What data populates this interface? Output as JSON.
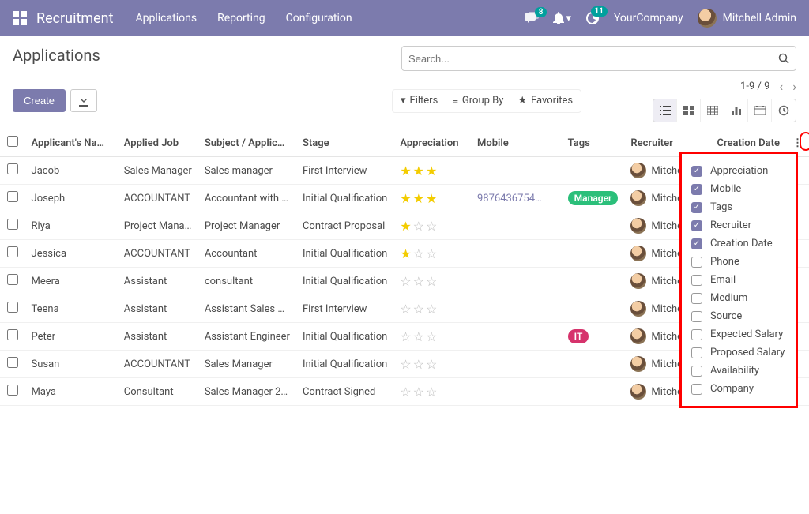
{
  "nav": {
    "brand": "Recruitment",
    "menu": [
      "Applications",
      "Reporting",
      "Configuration"
    ],
    "messages_badge": "8",
    "activities_badge": "11",
    "company": "YourCompany",
    "user": "Mitchell Admin"
  },
  "cp": {
    "title": "Applications",
    "create_label": "Create",
    "search_placeholder": "Search...",
    "filters_label": "Filters",
    "groupby_label": "Group By",
    "favorites_label": "Favorites",
    "pager": "1-9 / 9"
  },
  "columns": {
    "name": "Applicant's Na…",
    "job": "Applied Job",
    "subject": "Subject / Applic…",
    "stage": "Stage",
    "appreciation": "Appreciation",
    "mobile": "Mobile",
    "tags": "Tags",
    "recruiter": "Recruiter",
    "creation_date": "Creation Date"
  },
  "rows": [
    {
      "name": "Jacob",
      "job": "Sales Manager",
      "subject": "Sales manager",
      "stage": "First Interview",
      "appreciation": 3,
      "mobile": "",
      "tags": [],
      "recruiter": "Mitche…"
    },
    {
      "name": "Joseph",
      "job": "ACCOUNTANT",
      "subject": "Accountant with …",
      "stage": "Initial Qualification",
      "appreciation": 3,
      "mobile": "9876436754…",
      "tags": [
        "Manager"
      ],
      "recruiter": "Mitche…"
    },
    {
      "name": "Riya",
      "job": "Project Mana…",
      "subject": "Project Manager",
      "stage": "Contract Proposal",
      "appreciation": 1,
      "mobile": "",
      "tags": [],
      "recruiter": "Mitche…"
    },
    {
      "name": "Jessica",
      "job": "ACCOUNTANT",
      "subject": "Accountant",
      "stage": "Initial Qualification",
      "appreciation": 1,
      "mobile": "",
      "tags": [],
      "recruiter": "Mitche…"
    },
    {
      "name": "Meera",
      "job": "Assistant",
      "subject": "consultant",
      "stage": "Initial Qualification",
      "appreciation": 0,
      "mobile": "",
      "tags": [],
      "recruiter": "Mitche…"
    },
    {
      "name": "Teena",
      "job": "Assistant",
      "subject": "Assistant Sales …",
      "stage": "First Interview",
      "appreciation": 0,
      "mobile": "",
      "tags": [],
      "recruiter": "Mitche…"
    },
    {
      "name": "Peter",
      "job": "Assistant",
      "subject": "Assistant Engineer",
      "stage": "Initial Qualification",
      "appreciation": 0,
      "mobile": "",
      "tags": [
        "IT"
      ],
      "recruiter": "Mitche…"
    },
    {
      "name": "Susan",
      "job": "ACCOUNTANT",
      "subject": "Sales Manager",
      "stage": "Initial Qualification",
      "appreciation": 0,
      "mobile": "",
      "tags": [],
      "recruiter": "Mitche…"
    },
    {
      "name": "Maya",
      "job": "Consultant",
      "subject": "Sales Manager 2…",
      "stage": "Contract Signed",
      "appreciation": 0,
      "mobile": "",
      "tags": [],
      "recruiter": "Mitche…"
    }
  ],
  "optional_fields": [
    {
      "label": "Appreciation",
      "checked": true
    },
    {
      "label": "Mobile",
      "checked": true
    },
    {
      "label": "Tags",
      "checked": true
    },
    {
      "label": "Recruiter",
      "checked": true
    },
    {
      "label": "Creation Date",
      "checked": true
    },
    {
      "label": "Phone",
      "checked": false
    },
    {
      "label": "Email",
      "checked": false
    },
    {
      "label": "Medium",
      "checked": false
    },
    {
      "label": "Source",
      "checked": false
    },
    {
      "label": "Expected Salary",
      "checked": false
    },
    {
      "label": "Proposed Salary",
      "checked": false
    },
    {
      "label": "Availability",
      "checked": false
    },
    {
      "label": "Company",
      "checked": false
    }
  ]
}
